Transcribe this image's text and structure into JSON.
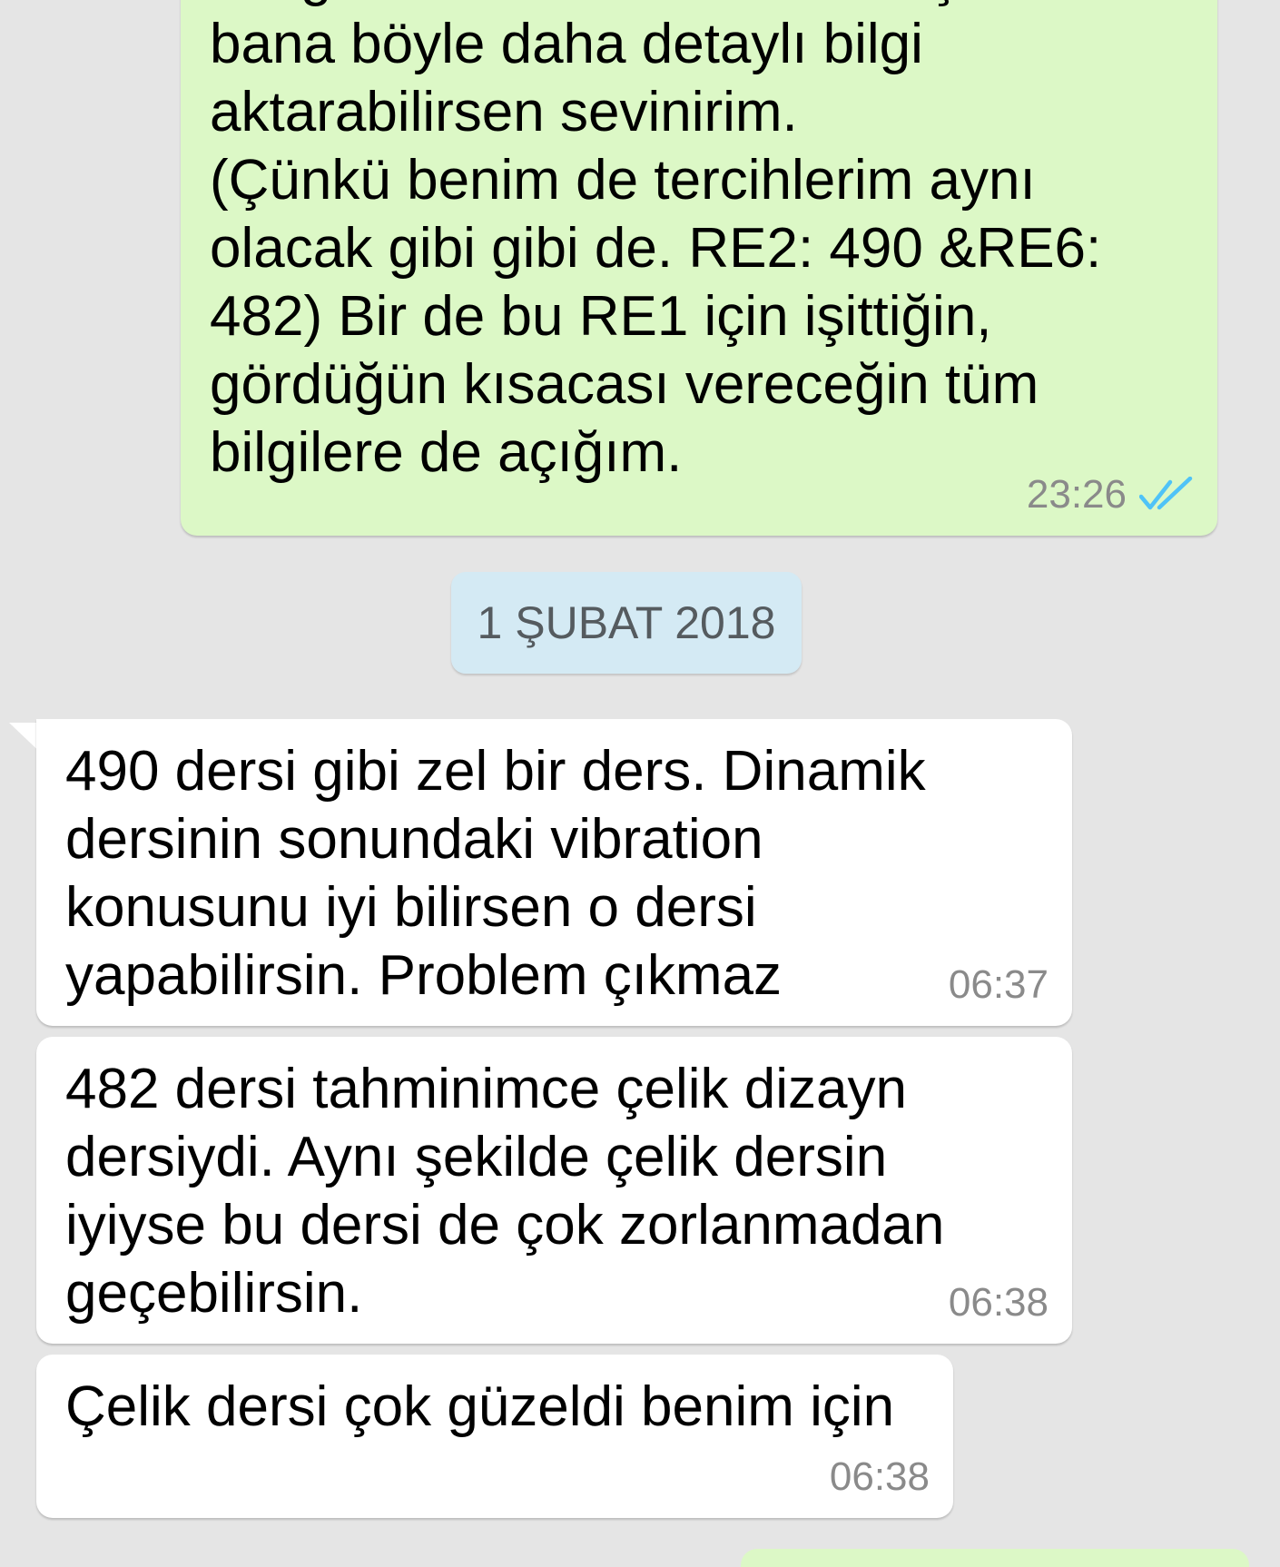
{
  "messages": [
    {
      "direction": "outgoing",
      "text": "aldığından az biraz bahsetmiştin ama\nbana böyle daha detaylı bilgi\naktarabilirsen sevinirim.\n(Çünkü benim de tercihlerim aynı\nolacak gibi gibi de. RE2: 490 &RE6:\n482) Bir de bu RE1 için işittiğin,\ngördüğün kısacası vereceğin tüm\nbilgilere de açığım.",
      "time": "23:26",
      "status_icon": "double-check-read-icon"
    },
    {
      "direction": "incoming",
      "text": "490 dersi gibi zel bir ders. Dinamik\ndersinin sonundaki vibration\nkonusunu iyi bilirsen o dersi\nyapabilirsin. Problem çıkmaz",
      "time": "06:37"
    },
    {
      "direction": "incoming",
      "text": "482 dersi tahminimce çelik dizayn\ndersiydi. Aynı şekilde çelik dersin\niyiyse bu dersi de çok zorlanmadan\ngeçebilirsin.",
      "time": "06:38"
    },
    {
      "direction": "incoming",
      "text": "Çelik dersi çok güzeldi benim için",
      "time": "06:38"
    }
  ],
  "date_separator": "1 ŞUBAT 2018",
  "colors": {
    "background": "#e5e5e5",
    "outgoing_bubble": "#dcf8c6",
    "incoming_bubble": "#ffffff",
    "date_chip": "#d4eaf4",
    "read_tick": "#4fc3f7",
    "timestamp": "#8a8a8a"
  }
}
